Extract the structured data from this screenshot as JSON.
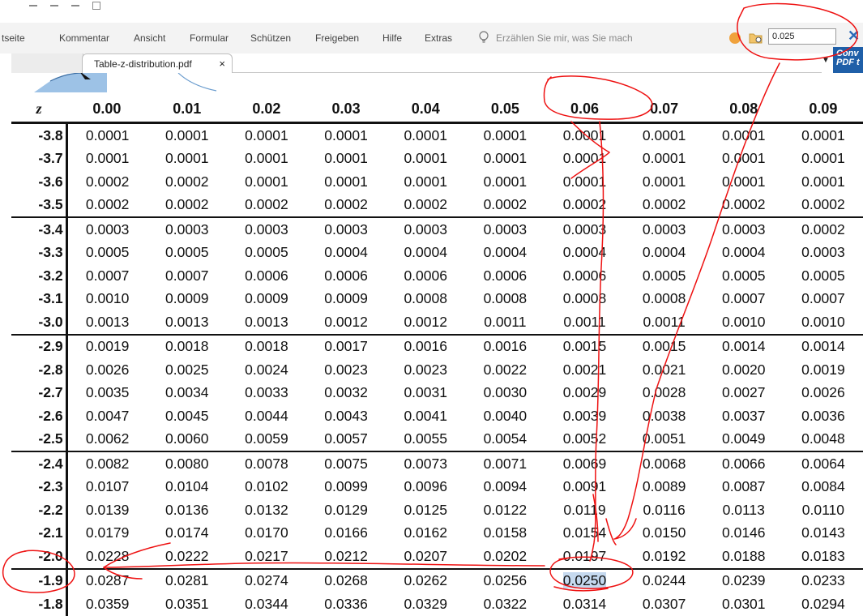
{
  "ribbon": {
    "tabs": [
      "tseite",
      "Kommentar",
      "Ansicht",
      "Formular",
      "Schützen",
      "Freigeben",
      "Hilfe",
      "Extras"
    ],
    "tell_me": "Erzählen Sie mir, was Sie mach "
  },
  "search": {
    "value": "0.025"
  },
  "document_tab": {
    "title": "Table-z-distribution.pdf",
    "close": "×"
  },
  "convert_button": {
    "label": "Conv\nPDF t"
  },
  "ztable": {
    "z_header": "z",
    "columns": [
      "0.00",
      "0.01",
      "0.02",
      "0.03",
      "0.04",
      "0.05",
      "0.06",
      "0.07",
      "0.08",
      "0.09"
    ],
    "rows": [
      {
        "z": "-3.8",
        "values": [
          "0.0001",
          "0.0001",
          "0.0001",
          "0.0001",
          "0.0001",
          "0.0001",
          "0.0001",
          "0.0001",
          "0.0001",
          "0.0001"
        ]
      },
      {
        "z": "-3.7",
        "values": [
          "0.0001",
          "0.0001",
          "0.0001",
          "0.0001",
          "0.0001",
          "0.0001",
          "0.0001",
          "0.0001",
          "0.0001",
          "0.0001"
        ]
      },
      {
        "z": "-3.6",
        "values": [
          "0.0002",
          "0.0002",
          "0.0001",
          "0.0001",
          "0.0001",
          "0.0001",
          "0.0001",
          "0.0001",
          "0.0001",
          "0.0001"
        ]
      },
      {
        "z": "-3.5",
        "values": [
          "0.0002",
          "0.0002",
          "0.0002",
          "0.0002",
          "0.0002",
          "0.0002",
          "0.0002",
          "0.0002",
          "0.0002",
          "0.0002"
        ]
      },
      {
        "z": "-3.4",
        "values": [
          "0.0003",
          "0.0003",
          "0.0003",
          "0.0003",
          "0.0003",
          "0.0003",
          "0.0003",
          "0.0003",
          "0.0003",
          "0.0002"
        ]
      },
      {
        "z": "-3.3",
        "values": [
          "0.0005",
          "0.0005",
          "0.0005",
          "0.0004",
          "0.0004",
          "0.0004",
          "0.0004",
          "0.0004",
          "0.0004",
          "0.0003"
        ]
      },
      {
        "z": "-3.2",
        "values": [
          "0.0007",
          "0.0007",
          "0.0006",
          "0.0006",
          "0.0006",
          "0.0006",
          "0.0006",
          "0.0005",
          "0.0005",
          "0.0005"
        ]
      },
      {
        "z": "-3.1",
        "values": [
          "0.0010",
          "0.0009",
          "0.0009",
          "0.0009",
          "0.0008",
          "0.0008",
          "0.0008",
          "0.0008",
          "0.0007",
          "0.0007"
        ]
      },
      {
        "z": "-3.0",
        "values": [
          "0.0013",
          "0.0013",
          "0.0013",
          "0.0012",
          "0.0012",
          "0.0011",
          "0.0011",
          "0.0011",
          "0.0010",
          "0.0010"
        ]
      },
      {
        "z": "-2.9",
        "values": [
          "0.0019",
          "0.0018",
          "0.0018",
          "0.0017",
          "0.0016",
          "0.0016",
          "0.0015",
          "0.0015",
          "0.0014",
          "0.0014"
        ]
      },
      {
        "z": "-2.8",
        "values": [
          "0.0026",
          "0.0025",
          "0.0024",
          "0.0023",
          "0.0023",
          "0.0022",
          "0.0021",
          "0.0021",
          "0.0020",
          "0.0019"
        ]
      },
      {
        "z": "-2.7",
        "values": [
          "0.0035",
          "0.0034",
          "0.0033",
          "0.0032",
          "0.0031",
          "0.0030",
          "0.0029",
          "0.0028",
          "0.0027",
          "0.0026"
        ]
      },
      {
        "z": "-2.6",
        "values": [
          "0.0047",
          "0.0045",
          "0.0044",
          "0.0043",
          "0.0041",
          "0.0040",
          "0.0039",
          "0.0038",
          "0.0037",
          "0.0036"
        ]
      },
      {
        "z": "-2.5",
        "values": [
          "0.0062",
          "0.0060",
          "0.0059",
          "0.0057",
          "0.0055",
          "0.0054",
          "0.0052",
          "0.0051",
          "0.0049",
          "0.0048"
        ]
      },
      {
        "z": "-2.4",
        "values": [
          "0.0082",
          "0.0080",
          "0.0078",
          "0.0075",
          "0.0073",
          "0.0071",
          "0.0069",
          "0.0068",
          "0.0066",
          "0.0064"
        ]
      },
      {
        "z": "-2.3",
        "values": [
          "0.0107",
          "0.0104",
          "0.0102",
          "0.0099",
          "0.0096",
          "0.0094",
          "0.0091",
          "0.0089",
          "0.0087",
          "0.0084"
        ]
      },
      {
        "z": "-2.2",
        "values": [
          "0.0139",
          "0.0136",
          "0.0132",
          "0.0129",
          "0.0125",
          "0.0122",
          "0.0119",
          "0.0116",
          "0.0113",
          "0.0110"
        ]
      },
      {
        "z": "-2.1",
        "values": [
          "0.0179",
          "0.0174",
          "0.0170",
          "0.0166",
          "0.0162",
          "0.0158",
          "0.0154",
          "0.0150",
          "0.0146",
          "0.0143"
        ]
      },
      {
        "z": "-2.0",
        "values": [
          "0.0228",
          "0.0222",
          "0.0217",
          "0.0212",
          "0.0207",
          "0.0202",
          "0.0197",
          "0.0192",
          "0.0188",
          "0.0183"
        ]
      },
      {
        "z": "-1.9",
        "values": [
          "0.0287",
          "0.0281",
          "0.0274",
          "0.0268",
          "0.0262",
          "0.0256",
          "0.0250",
          "0.0244",
          "0.0239",
          "0.0233"
        ]
      },
      {
        "z": "-1.8",
        "values": [
          "0.0359",
          "0.0351",
          "0.0344",
          "0.0336",
          "0.0329",
          "0.0322",
          "0.0314",
          "0.0307",
          "0.0301",
          "0.0294"
        ]
      }
    ],
    "group_starts": [
      4,
      9,
      14,
      19
    ],
    "highlight": {
      "row": 19,
      "col": 6
    }
  },
  "colors": {
    "annotation": "#ee1111",
    "highlight": "#c5d9ef",
    "accent": "#1f5fa8"
  }
}
